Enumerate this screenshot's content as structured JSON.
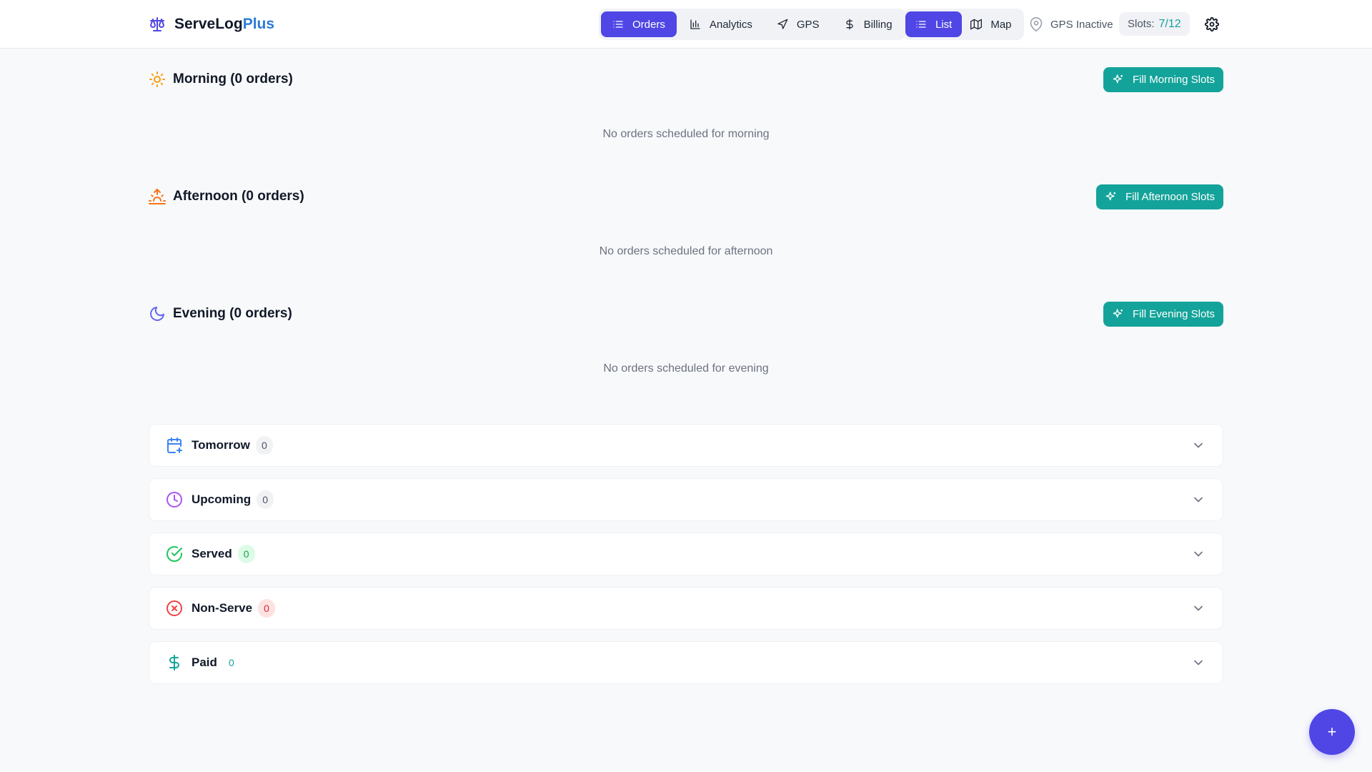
{
  "brand": {
    "name": "ServeLog",
    "suffix": "Plus",
    "icon": "scale-icon"
  },
  "nav": {
    "views": [
      {
        "label": "Orders",
        "icon": "list-icon",
        "active": true
      },
      {
        "label": "Analytics",
        "icon": "bar-chart-icon",
        "active": false
      },
      {
        "label": "GPS",
        "icon": "navigation-icon",
        "active": false
      },
      {
        "label": "Billing",
        "icon": "dollar-icon",
        "active": false
      }
    ],
    "modes": [
      {
        "label": "List",
        "icon": "list-icon",
        "active": true
      },
      {
        "label": "Map",
        "icon": "map-icon",
        "active": false
      }
    ]
  },
  "gps": {
    "label": "GPS Inactive",
    "icon": "map-pin-icon"
  },
  "slots": {
    "label": "Slots:",
    "value": "7/12"
  },
  "settings": {
    "icon": "gear-icon"
  },
  "sections": [
    {
      "title": "Morning (0 orders)",
      "icon": "sun-icon",
      "icon_color": "#f59e0b",
      "button": "Fill Morning Slots",
      "empty": "No orders scheduled for morning"
    },
    {
      "title": "Afternoon (0 orders)",
      "icon": "sunset-icon",
      "icon_color": "#f97316",
      "button": "Fill Afternoon Slots",
      "empty": "No orders scheduled for afternoon"
    },
    {
      "title": "Evening (0 orders)",
      "icon": "moon-icon",
      "icon_color": "#6366f1",
      "button": "Fill Evening Slots",
      "empty": "No orders scheduled for evening"
    }
  ],
  "groups": [
    {
      "label": "Tomorrow",
      "count": "0",
      "icon": "calendar-plus-icon",
      "icon_color": "#3b82f6"
    },
    {
      "label": "Upcoming",
      "count": "0",
      "icon": "clock-icon",
      "icon_color": "#a855f7"
    },
    {
      "label": "Served",
      "count": "0",
      "icon": "check-circle-icon",
      "icon_color": "#22c55e"
    },
    {
      "label": "Non-Serve",
      "count": "0",
      "icon": "x-circle-icon",
      "icon_color": "#ef4444"
    },
    {
      "label": "Paid",
      "count": "0",
      "icon": "dollar-icon",
      "icon_color": "#14a39a"
    }
  ],
  "fab": {
    "label": "+"
  },
  "colors": {
    "primary": "#4f46e5",
    "teal": "#14a39a",
    "brand_accent": "#2b7bd6"
  }
}
